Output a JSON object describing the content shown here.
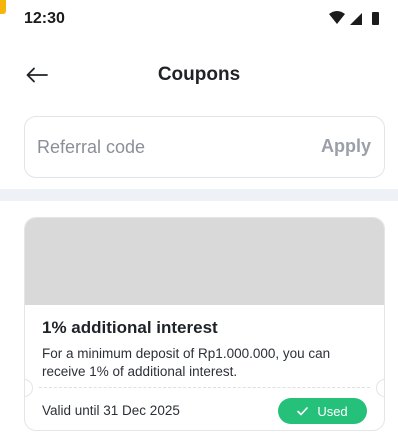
{
  "status_bar": {
    "time": "12:30",
    "icons": [
      "wifi-icon",
      "signal-icon",
      "battery-icon"
    ]
  },
  "header": {
    "title": "Coupons",
    "back_icon": "arrow-left-icon"
  },
  "referral": {
    "placeholder": "Referral code",
    "value": "",
    "apply_label": "Apply"
  },
  "coupons": [
    {
      "title": "1% additional interest",
      "description": "For a minimum deposit of Rp1.000.000, you can receive 1% of additional interest.",
      "validity": "Valid until 31 Dec 2025",
      "status": "Used",
      "status_icon": "check-icon"
    }
  ],
  "colors": {
    "accent_status": "#25c07a",
    "image_placeholder": "#d9d9d9",
    "divider": "#eef1f5"
  }
}
